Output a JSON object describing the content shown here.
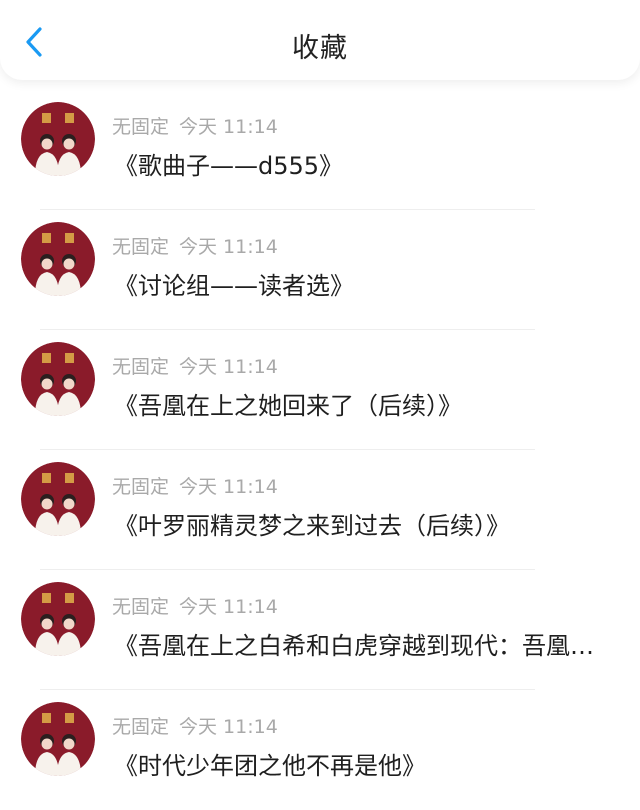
{
  "header": {
    "title": "收藏",
    "back_icon": "chevron-left-icon",
    "accent_color": "#1a9af3"
  },
  "avatar_colors": {
    "background": "#8a1b2a",
    "text": "#e0b24a"
  },
  "items": [
    {
      "author": "无固定",
      "time": "今天 11:14",
      "title": "《歌曲子——d555》"
    },
    {
      "author": "无固定",
      "time": "今天 11:14",
      "title": "《讨论组——读者选》"
    },
    {
      "author": "无固定",
      "time": "今天 11:14",
      "title": "《吾凰在上之她回来了（后续）》"
    },
    {
      "author": "无固定",
      "time": "今天 11:14",
      "title": "《叶罗丽精灵梦之来到过去（后续）》"
    },
    {
      "author": "无固定",
      "time": "今天 11:14",
      "title": "《吾凰在上之白希和白虎穿越到现代：吾凰…"
    },
    {
      "author": "无固定",
      "time": "今天 11:14",
      "title": "《时代少年团之他不再是他》"
    }
  ]
}
